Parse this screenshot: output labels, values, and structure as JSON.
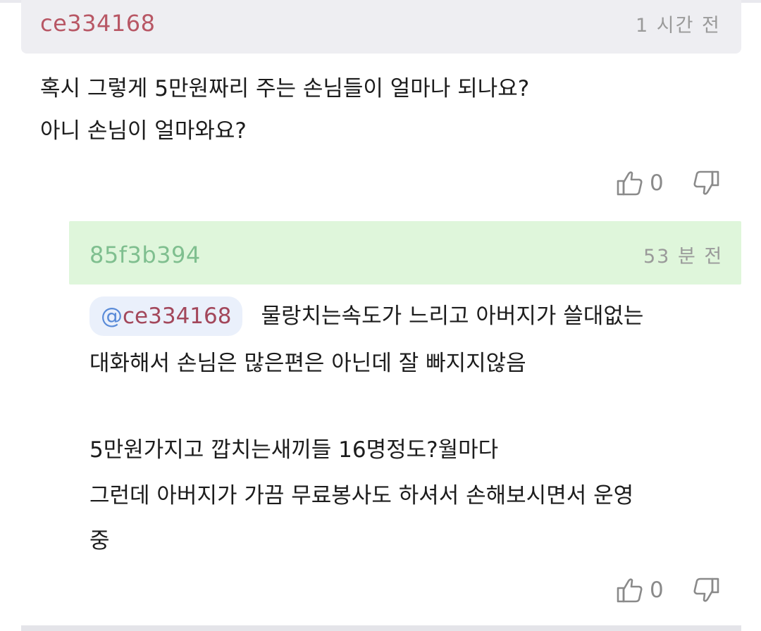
{
  "comment": {
    "username": "ce334168",
    "time": "1 시간 전",
    "lines": [
      "혹시 그렇게 5만원짜리 주는 손님들이 얼마나 되나요?",
      "아니 손님이 얼마와요?"
    ],
    "likes": "0",
    "colors": {
      "username": "#b85765",
      "header_bg": "#eeeef2"
    }
  },
  "reply": {
    "username": "85f3b394",
    "time": "53 분 전",
    "mention_at": "@",
    "mention_user": "ce334168",
    "line1_rest": "물랑치는속도가 느리고 아버지가 쓸대없는",
    "line2": "대화해서 손님은 많은편은 아닌데 잘 빠지지않음",
    "line3": "5만원가지고 깝치는새끼들 16명정도?월마다",
    "line4": "그런데 아버지가 가끔 무료봉사도 하셔서 손해보시면서 운영",
    "line5": "중",
    "likes": "0",
    "colors": {
      "username": "#7fbf8f",
      "header_bg": "#dff6db"
    }
  },
  "icons": {
    "like": "thumbs-up-icon",
    "dislike": "thumbs-down-icon"
  }
}
